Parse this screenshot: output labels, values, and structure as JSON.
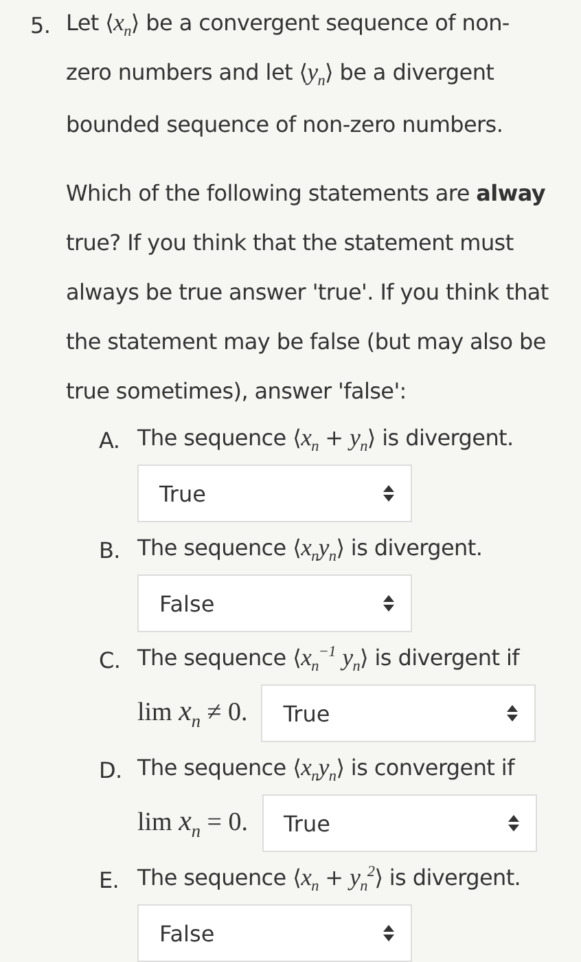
{
  "question": {
    "number": "5.",
    "lines": [
      "Let ⟨*x*$_{n}$⟩ be a convergent sequence of non-",
      "zero numbers and let ⟨*y*$_{n}$⟩ be a divergent",
      "bounded sequence of non-zero numbers."
    ]
  },
  "instructions": [
    "Which of the following statements are **alway**",
    "true? If you think that the statement must",
    "always be true answer 'true'. If you think that",
    "the statement may be false (but may also be",
    "true sometimes), answer 'false':"
  ],
  "statements": [
    {
      "kind": "block",
      "letter": "A.",
      "text": "The sequence ⟨*x*$_{n}$ + *y*$_{n}$⟩ is divergent.",
      "answer": "True"
    },
    {
      "kind": "block",
      "letter": "B.",
      "text": "The sequence ⟨*x*$_{n}$*y*$_{n}$⟩ is divergent.",
      "answer": "False"
    },
    {
      "kind": "inline",
      "letter": "C.",
      "text": "The sequence ⟨*x*$_{n}$$^{−1}$ *y*$_{n}$⟩ is divergent if",
      "condition": "lim *x*$_{n}$ ≠ 0.",
      "answer": "True"
    },
    {
      "kind": "inline",
      "letter": "D.",
      "text": "The sequence ⟨*x*$_{n}$*y*$_{n}$⟩ is convergent if",
      "condition": "lim *x*$_{n}$ = 0.",
      "answer": "True"
    },
    {
      "kind": "block",
      "letter": "E.",
      "text": "The sequence ⟨*x*$_{n}$ + *y*$_{n}$$^{2}$⟩ is divergent.",
      "answer": "False"
    }
  ]
}
